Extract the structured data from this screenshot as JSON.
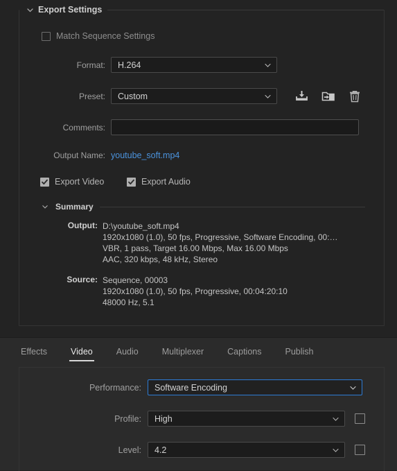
{
  "export_panel": {
    "title": "Export Settings",
    "collapse_icon": "chevron-down-icon",
    "match_sequence": {
      "label": "Match Sequence Settings",
      "checked": false
    },
    "format": {
      "label": "Format:",
      "value": "H.264"
    },
    "preset": {
      "label": "Preset:",
      "value": "Custom",
      "actions": [
        {
          "name": "save-preset-icon",
          "tooltip": "Save Preset"
        },
        {
          "name": "import-preset-icon",
          "tooltip": "Import Preset"
        },
        {
          "name": "delete-preset-icon",
          "tooltip": "Delete Preset"
        }
      ]
    },
    "comments": {
      "label": "Comments:",
      "value": "",
      "placeholder": ""
    },
    "output_name": {
      "label": "Output Name:",
      "value": "youtube_soft.mp4",
      "link_color": "#4b93dd"
    },
    "export_video": {
      "label": "Export Video",
      "checked": true
    },
    "export_audio": {
      "label": "Export Audio",
      "checked": true
    },
    "summary": {
      "title": "Summary",
      "collapse_icon": "chevron-down-icon",
      "output": {
        "key": "Output:",
        "lines": [
          "D:\\youtube_soft.mp4",
          "1920x1080 (1.0), 50 fps, Progressive, Software Encoding, 00:…",
          "VBR, 1 pass, Target 16.00 Mbps, Max 16.00 Mbps",
          "AAC, 320 kbps, 48 kHz, Stereo"
        ]
      },
      "source": {
        "key": "Source:",
        "lines": [
          "Sequence, 00003",
          "1920x1080 (1.0), 50 fps, Progressive, 00:04:20:10",
          "48000 Hz, 5.1"
        ]
      }
    }
  },
  "bottom_panel": {
    "tabs": [
      {
        "label": "Effects",
        "active": false
      },
      {
        "label": "Video",
        "active": true
      },
      {
        "label": "Audio",
        "active": false
      },
      {
        "label": "Multiplexer",
        "active": false
      },
      {
        "label": "Captions",
        "active": false
      },
      {
        "label": "Publish",
        "active": false
      }
    ],
    "performance": {
      "label": "Performance:",
      "value": "Software Encoding",
      "focused": true,
      "focus_color": "#2d7cd6"
    },
    "profile": {
      "label": "Profile:",
      "value": "High",
      "checkbox_checked": false
    },
    "level": {
      "label": "Level:",
      "value": "4.2",
      "checkbox_checked": false
    }
  }
}
